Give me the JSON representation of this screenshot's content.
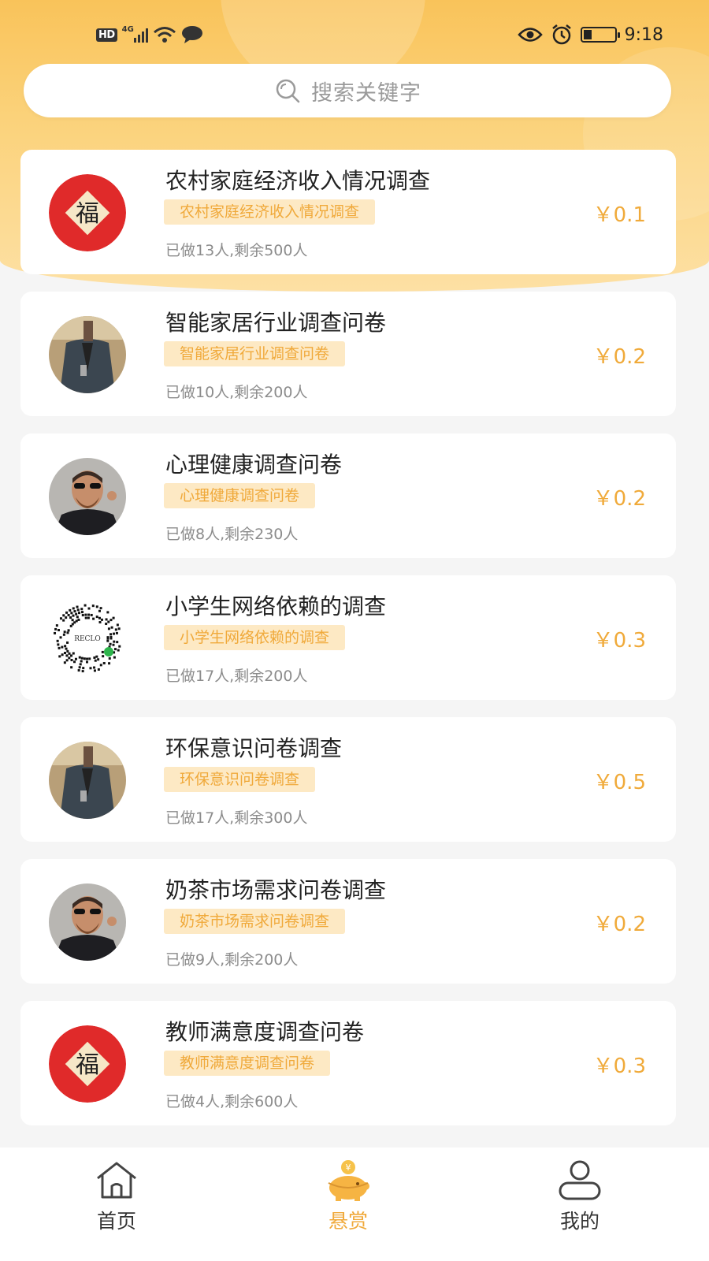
{
  "status_bar": {
    "hd": "HD",
    "network": "4G",
    "time": "9:18"
  },
  "search": {
    "placeholder": "搜索关键字"
  },
  "colors": {
    "accent": "#f0a93a",
    "tag_bg": "#fde9c4",
    "header_gradient_top": "#f9c35a",
    "header_gradient_bottom": "#fde0a4"
  },
  "surveys": [
    {
      "title": "农村家庭经济收入情况调查",
      "tag": "农村家庭经济收入情况调查",
      "stats": "已做13人,剩余500人",
      "price": "￥0.1",
      "avatar": "fu-icon"
    },
    {
      "title": "智能家居行业调查问卷",
      "tag": "智能家居行业调查问卷",
      "stats": "已做10人,剩余200人",
      "price": "￥0.2",
      "avatar": "man-jacket-avatar"
    },
    {
      "title": "心理健康调查问卷",
      "tag": "心理健康调查问卷",
      "stats": "已做8人,剩余230人",
      "price": "￥0.2",
      "avatar": "man-suit-avatar"
    },
    {
      "title": "小学生网络依赖的调查",
      "tag": "小学生网络依赖的调查",
      "stats": "已做17人,剩余200人",
      "price": "￥0.3",
      "avatar": "qr-code-avatar",
      "avatar_text": "RECLO"
    },
    {
      "title": "环保意识问卷调查",
      "tag": "环保意识问卷调查",
      "stats": "已做17人,剩余300人",
      "price": "￥0.5",
      "avatar": "man-jacket-avatar"
    },
    {
      "title": "奶茶市场需求问卷调查",
      "tag": "奶茶市场需求问卷调查",
      "stats": "已做9人,剩余200人",
      "price": "￥0.2",
      "avatar": "man-suit-avatar"
    },
    {
      "title": "教师满意度调查问卷",
      "tag": "教师满意度调查问卷",
      "stats": "已做4人,剩余600人",
      "price": "￥0.3",
      "avatar": "fu-icon"
    }
  ],
  "fu_char": "福",
  "tabbar": {
    "home": "首页",
    "reward": "悬赏",
    "mine": "我的",
    "active": "reward"
  }
}
